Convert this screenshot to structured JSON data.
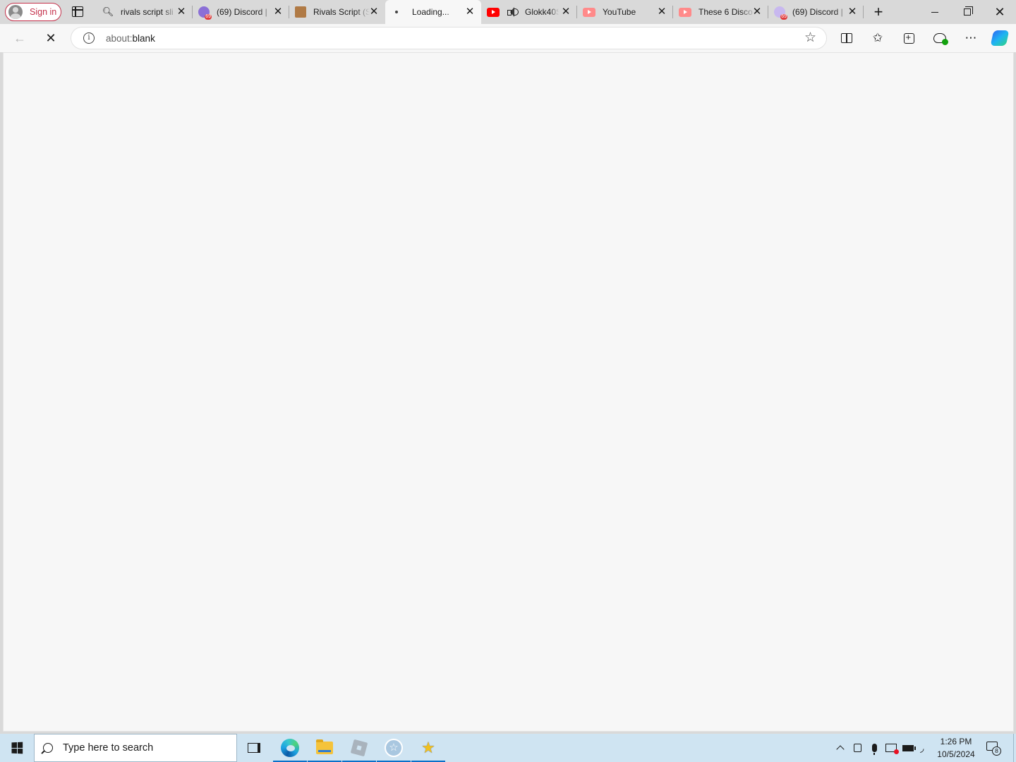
{
  "browser": {
    "signin_label": "Sign in",
    "tabs": [
      {
        "title": "rivals script sli",
        "favicon": "search-icon"
      },
      {
        "title": "(69) Discord |",
        "favicon": "discord-icon"
      },
      {
        "title": "Rivals Script (S",
        "favicon": "rivals-icon"
      },
      {
        "title": "Loading...",
        "favicon": "loading-icon",
        "active": true
      },
      {
        "title": "Glokk40S",
        "favicon": "youtube-icon",
        "audio": true
      },
      {
        "title": "YouTube",
        "favicon": "youtube-icon"
      },
      {
        "title": "These 6 Disco",
        "favicon": "youtube-icon"
      },
      {
        "title": "(69) Discord |",
        "favicon": "discord-icon"
      }
    ],
    "address": {
      "prefix": "about:",
      "host": "blank"
    }
  },
  "taskbar": {
    "search_placeholder": "Type here to search",
    "time": "1:26 PM",
    "date": "10/5/2024",
    "notification_count": "8"
  },
  "colors": {
    "signin_accent": "#c4314b",
    "taskbar_bg": "#cfe4f2",
    "content_bg": "#f7f7f7",
    "running_indicator": "#0a70c9"
  }
}
